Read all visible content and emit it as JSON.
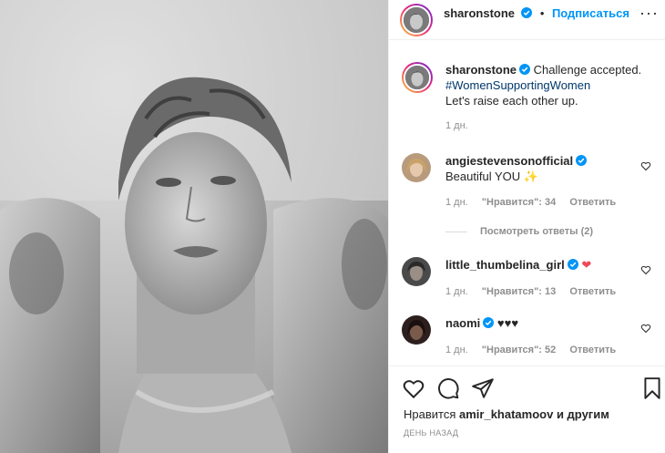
{
  "header": {
    "username": "sharonstone",
    "separator": "•",
    "follow_label": "Подписаться",
    "more": "···"
  },
  "caption": {
    "username": "sharonstone",
    "text": "Challenge accepted.",
    "hashtag": "#WomenSupportingWomen",
    "line3": "Let's raise each other up.",
    "time": "1 дн."
  },
  "comments": [
    {
      "username": "angiestevensonofficial",
      "text": "Beautiful YOU",
      "emoji": "✨",
      "time": "1 дн.",
      "likes": "\"Нравится\": 34",
      "reply": "Ответить",
      "view_replies": "Посмотреть ответы (2)"
    },
    {
      "username": "little_thumbelina_girl",
      "text": "",
      "emoji": "❤",
      "time": "1 дн.",
      "likes": "\"Нравится\": 13",
      "reply": "Ответить"
    },
    {
      "username": "naomi",
      "text": "♥♥♥",
      "emoji": "",
      "time": "1 дн.",
      "likes": "\"Нравится\": 52",
      "reply": "Ответить"
    }
  ],
  "likes_line": {
    "prefix": "Нравится",
    "user": "amir_khatamoov",
    "suffix": "и другим"
  },
  "date": "ДЕНЬ НАЗАД",
  "icons": {
    "verified": "verified-badge-icon",
    "more": "more-options-icon",
    "heart": "heart-icon",
    "comment": "comment-icon",
    "share": "share-icon",
    "save": "bookmark-icon"
  },
  "colors": {
    "accent": "#0095f6",
    "text": "#262626",
    "muted": "#8e8e8e",
    "hashtag": "#00376b",
    "heart_red": "#ed4956"
  }
}
